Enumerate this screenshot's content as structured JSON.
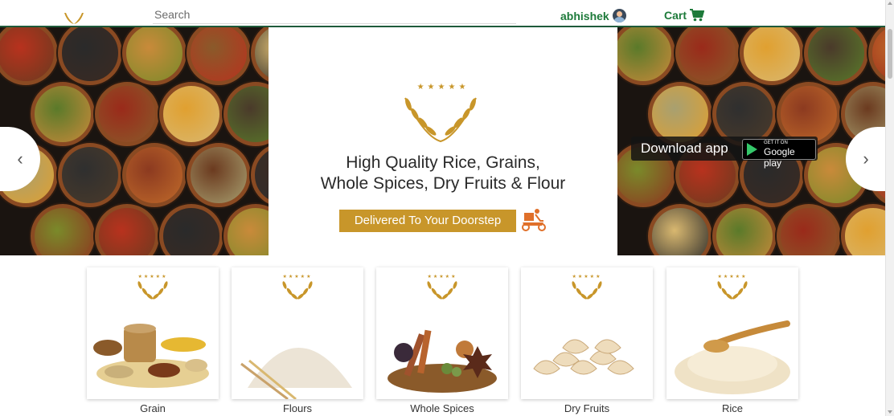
{
  "header": {
    "search_placeholder": "Search",
    "username": "abhishek",
    "cart_label": "Cart"
  },
  "banner": {
    "headline_line1": "High Quality Rice, Grains,",
    "headline_line2": "Whole Spices, Dry Fruits & Flour",
    "delivered_label": "Delivered To Your Doorstep",
    "download_label": "Download app",
    "gplay_small": "GET IT ON",
    "gplay_big": "Google play",
    "prev_label": "‹",
    "next_label": "›",
    "rating_stars": "★★★★★"
  },
  "categories": [
    {
      "label": "Grain",
      "icon": "grain-sacks-image"
    },
    {
      "label": "Flours",
      "icon": "flour-pile-image"
    },
    {
      "label": "Whole Spices",
      "icon": "spices-image"
    },
    {
      "label": "Dry Fruits",
      "icon": "cashews-image"
    },
    {
      "label": "Rice",
      "icon": "rice-pile-image"
    }
  ],
  "colors": {
    "brand_green": "#1d7a3a",
    "gold": "#c8962a",
    "header_border": "#1e5a3a"
  }
}
